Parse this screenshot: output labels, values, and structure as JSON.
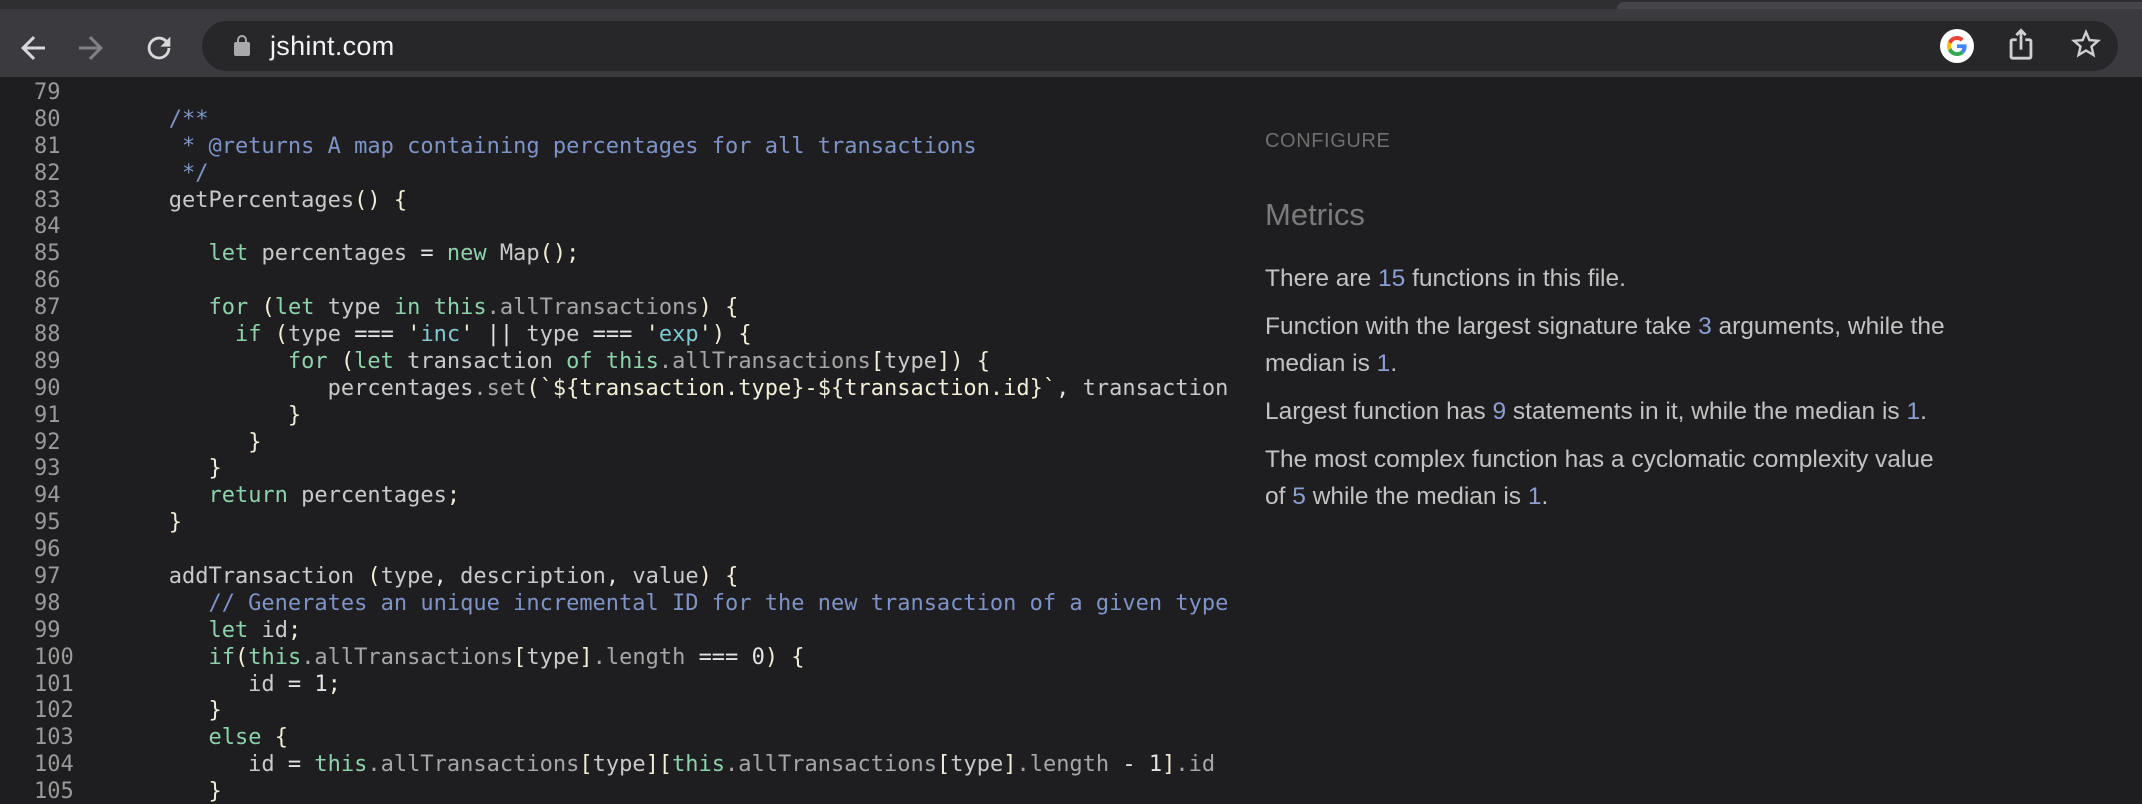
{
  "browser": {
    "url": "jshint.com",
    "icons": {
      "back": "back-arrow-icon",
      "forward": "forward-arrow-icon",
      "reload": "reload-icon",
      "lock": "secure-lock-icon",
      "google": "google-logo-icon",
      "share": "share-icon",
      "bookmark": "bookmark-star-icon"
    }
  },
  "colors": {
    "page_bg": "#1e1e20",
    "toolbar_bg": "#3b3b3f",
    "omnibox_bg": "#27272a",
    "keyword": "#8dd2ab",
    "string": "#7fc9d2",
    "comment": "#7e93c8",
    "bracket": "#f1eed7",
    "identifier": "#c9c9c9",
    "line_number": "#9a9a9a",
    "metric_number": "#8b9fd4",
    "metric_text": "#c2c2c2"
  },
  "editor": {
    "lines": [
      {
        "num": "79",
        "tokens": []
      },
      {
        "num": "80",
        "tokens": [
          [
            "c",
            "       /**"
          ]
        ]
      },
      {
        "num": "81",
        "tokens": [
          [
            "c",
            "        * @returns A map containing percentages for all transactions"
          ]
        ]
      },
      {
        "num": "82",
        "tokens": [
          [
            "c",
            "        */"
          ]
        ]
      },
      {
        "num": "83",
        "tokens": [
          [
            "v",
            "       getPercentages"
          ],
          [
            "b",
            "() {"
          ]
        ]
      },
      {
        "num": "84",
        "tokens": []
      },
      {
        "num": "85",
        "tokens": [
          [
            "v",
            "          "
          ],
          [
            "k",
            "let"
          ],
          [
            "v",
            " percentages "
          ],
          [
            "o",
            "="
          ],
          [
            "v",
            " "
          ],
          [
            "k",
            "new"
          ],
          [
            "v",
            " Map"
          ],
          [
            "b",
            "();"
          ]
        ]
      },
      {
        "num": "86",
        "tokens": []
      },
      {
        "num": "87",
        "tokens": [
          [
            "v",
            "          "
          ],
          [
            "k",
            "for"
          ],
          [
            "v",
            " "
          ],
          [
            "b",
            "("
          ],
          [
            "k",
            "let"
          ],
          [
            "v",
            " type "
          ],
          [
            "k",
            "in"
          ],
          [
            "v",
            " "
          ],
          [
            "k",
            "this"
          ],
          [
            "p",
            ".allTransactions"
          ],
          [
            "b",
            ") {"
          ]
        ]
      },
      {
        "num": "88",
        "tokens": [
          [
            "v",
            "            "
          ],
          [
            "k",
            "if"
          ],
          [
            "v",
            " "
          ],
          [
            "b",
            "("
          ],
          [
            "v",
            "type "
          ],
          [
            "o",
            "==="
          ],
          [
            "v",
            " "
          ],
          [
            "b",
            "'"
          ],
          [
            "s",
            "inc"
          ],
          [
            "b",
            "'"
          ],
          [
            "v",
            " "
          ],
          [
            "o",
            "||"
          ],
          [
            "v",
            " type "
          ],
          [
            "o",
            "==="
          ],
          [
            "v",
            " "
          ],
          [
            "b",
            "'"
          ],
          [
            "s",
            "exp"
          ],
          [
            "b",
            "'"
          ],
          [
            "b",
            ") {"
          ]
        ]
      },
      {
        "num": "89",
        "tokens": [
          [
            "v",
            "                "
          ],
          [
            "k",
            "for"
          ],
          [
            "v",
            " "
          ],
          [
            "b",
            "("
          ],
          [
            "k",
            "let"
          ],
          [
            "v",
            " transaction "
          ],
          [
            "k",
            "of"
          ],
          [
            "v",
            " "
          ],
          [
            "k",
            "this"
          ],
          [
            "p",
            ".allTransactions"
          ],
          [
            "b",
            "["
          ],
          [
            "v",
            "type"
          ],
          [
            "b",
            "]) {"
          ]
        ]
      },
      {
        "num": "90",
        "tokens": [
          [
            "v",
            "                   percentages"
          ],
          [
            "p",
            ".set"
          ],
          [
            "b",
            "(`${transaction.type}-${transaction.id}`"
          ],
          [
            "o",
            ","
          ],
          [
            "v",
            " transaction"
          ]
        ]
      },
      {
        "num": "91",
        "tokens": [
          [
            "v",
            "                "
          ],
          [
            "b",
            "}"
          ]
        ]
      },
      {
        "num": "92",
        "tokens": [
          [
            "v",
            "             "
          ],
          [
            "b",
            "}"
          ]
        ]
      },
      {
        "num": "93",
        "tokens": [
          [
            "v",
            "          "
          ],
          [
            "b",
            "}"
          ]
        ]
      },
      {
        "num": "94",
        "tokens": [
          [
            "v",
            "          "
          ],
          [
            "k",
            "return"
          ],
          [
            "v",
            " percentages"
          ],
          [
            "b",
            ";"
          ]
        ]
      },
      {
        "num": "95",
        "tokens": [
          [
            "v",
            "       "
          ],
          [
            "b",
            "}"
          ]
        ]
      },
      {
        "num": "96",
        "tokens": []
      },
      {
        "num": "97",
        "tokens": [
          [
            "v",
            "       addTransaction "
          ],
          [
            "b",
            "("
          ],
          [
            "v",
            "type"
          ],
          [
            "o",
            ","
          ],
          [
            "v",
            " description"
          ],
          [
            "o",
            ","
          ],
          [
            "v",
            " value"
          ],
          [
            "b",
            ") {"
          ]
        ]
      },
      {
        "num": "98",
        "tokens": [
          [
            "c",
            "          // Generates an unique incremental ID for the new transaction of a given type"
          ]
        ]
      },
      {
        "num": "99",
        "tokens": [
          [
            "v",
            "          "
          ],
          [
            "k",
            "let"
          ],
          [
            "v",
            " id"
          ],
          [
            "b",
            ";"
          ]
        ]
      },
      {
        "num": "100",
        "tokens": [
          [
            "v",
            "          "
          ],
          [
            "k",
            "if"
          ],
          [
            "b",
            "("
          ],
          [
            "k",
            "this"
          ],
          [
            "p",
            ".allTransactions"
          ],
          [
            "b",
            "["
          ],
          [
            "v",
            "type"
          ],
          [
            "b",
            "]"
          ],
          [
            "p",
            ".length"
          ],
          [
            "v",
            " "
          ],
          [
            "o",
            "==="
          ],
          [
            "v",
            " "
          ],
          [
            "n",
            "0"
          ],
          [
            "b",
            ") {"
          ]
        ]
      },
      {
        "num": "101",
        "tokens": [
          [
            "v",
            "             id "
          ],
          [
            "o",
            "="
          ],
          [
            "v",
            " "
          ],
          [
            "n",
            "1"
          ],
          [
            "b",
            ";"
          ]
        ]
      },
      {
        "num": "102",
        "tokens": [
          [
            "v",
            "          "
          ],
          [
            "b",
            "}"
          ]
        ]
      },
      {
        "num": "103",
        "tokens": [
          [
            "v",
            "          "
          ],
          [
            "k",
            "else"
          ],
          [
            "v",
            " "
          ],
          [
            "b",
            "{"
          ]
        ]
      },
      {
        "num": "104",
        "tokens": [
          [
            "v",
            "             id "
          ],
          [
            "o",
            "="
          ],
          [
            "v",
            " "
          ],
          [
            "k",
            "this"
          ],
          [
            "p",
            ".allTransactions"
          ],
          [
            "b",
            "["
          ],
          [
            "v",
            "type"
          ],
          [
            "b",
            "]["
          ],
          [
            "k",
            "this"
          ],
          [
            "p",
            ".allTransactions"
          ],
          [
            "b",
            "["
          ],
          [
            "v",
            "type"
          ],
          [
            "b",
            "]"
          ],
          [
            "p",
            ".length"
          ],
          [
            "v",
            " "
          ],
          [
            "o",
            "-"
          ],
          [
            "v",
            " "
          ],
          [
            "n",
            "1"
          ],
          [
            "b",
            "]"
          ],
          [
            "p",
            ".id"
          ]
        ]
      },
      {
        "num": "105",
        "tokens": [
          [
            "v",
            "          "
          ],
          [
            "b",
            "}"
          ]
        ]
      }
    ]
  },
  "panel": {
    "configure_label": "CONFIGURE",
    "metrics_title": "Metrics",
    "paragraphs": [
      {
        "segments": [
          [
            "t",
            "There are "
          ],
          [
            "n",
            "15"
          ],
          [
            "t",
            " functions in this file."
          ]
        ]
      },
      {
        "segments": [
          [
            "t",
            "Function with the largest signature take "
          ],
          [
            "n",
            "3"
          ],
          [
            "t",
            " arguments, while the"
          ],
          [
            "br",
            ""
          ],
          [
            "t",
            "median is "
          ],
          [
            "n",
            "1"
          ],
          [
            "t",
            "."
          ]
        ]
      },
      {
        "segments": [
          [
            "t",
            "Largest function has "
          ],
          [
            "n",
            "9"
          ],
          [
            "t",
            " statements in it, while the median is "
          ],
          [
            "n",
            "1"
          ],
          [
            "t",
            "."
          ]
        ]
      },
      {
        "segments": [
          [
            "t",
            "The most complex function has a cyclomatic complexity value"
          ],
          [
            "br",
            ""
          ],
          [
            "t",
            "of "
          ],
          [
            "n",
            "5"
          ],
          [
            "t",
            " while the median is "
          ],
          [
            "n",
            "1"
          ],
          [
            "t",
            "."
          ]
        ]
      }
    ]
  }
}
